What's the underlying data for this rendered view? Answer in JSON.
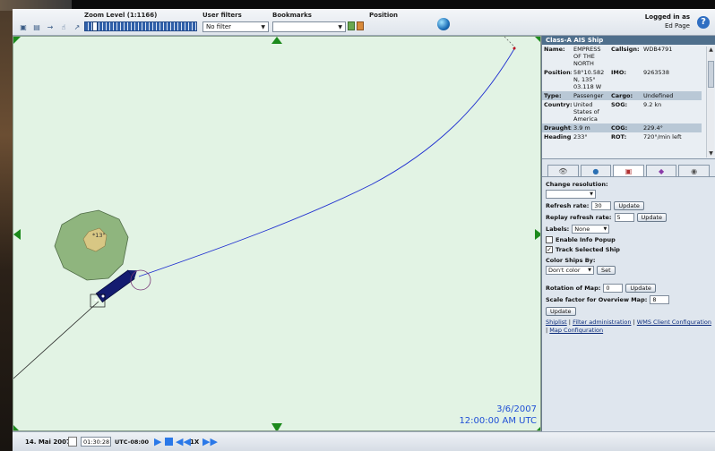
{
  "toolbar": {
    "zoom_label": "Zoom Level (1:1166)",
    "user_filters_label": "User filters",
    "user_filters_value": "No filter",
    "bookmarks_label": "Bookmarks",
    "bookmarks_value": "",
    "position_label": "Position",
    "logged_in_label": "Logged in as",
    "username": "Ed Page",
    "help_symbol": "?"
  },
  "map": {
    "timestamp_date": "3/6/2007",
    "timestamp_time": "12:00:00 AM UTC",
    "feature_label": "*13\"",
    "colors": {
      "background": "#e2f3e4",
      "island": "#8fb57e",
      "island_core": "#d8c784",
      "ship": "#141c70",
      "track": "#2030d0",
      "marker": "#1c8a1c"
    }
  },
  "ship_info": {
    "title": "Class-A AIS Ship",
    "rows": [
      {
        "k1": "Name:",
        "v1": "EMPRESS OF THE NORTH",
        "k2": "Callsign:",
        "v2": "WDB4791"
      },
      {
        "k1": "Position:",
        "v1": "58°10.582 N, 135° 03.118 W",
        "k2": "IMO:",
        "v2": "9263538"
      },
      {
        "k1": "Type:",
        "v1": "Passenger",
        "k2": "Cargo:",
        "v2": "Undefined"
      },
      {
        "k1": "Country:",
        "v1": "United States of America",
        "k2": "SOG:",
        "v2": "9.2 kn"
      },
      {
        "k1": "Draught:",
        "v1": "3.9 m",
        "k2": "COG:",
        "v2": "229.4°"
      },
      {
        "k1": "Heading:",
        "v1": "233°",
        "k2": "ROT:",
        "v2": "720°/min left"
      }
    ]
  },
  "tabs": [
    {
      "icon": "eye-icon",
      "glyph": "👁"
    },
    {
      "icon": "globe-icon",
      "glyph": "●"
    },
    {
      "icon": "document-icon",
      "glyph": "▣"
    },
    {
      "icon": "layers-icon",
      "glyph": "◆"
    },
    {
      "icon": "view-icon",
      "glyph": "◉"
    }
  ],
  "settings": {
    "change_resolution_label": "Change resolution:",
    "resolution_value": "",
    "refresh_rate_label": "Refresh rate:",
    "refresh_rate_value": "30",
    "replay_refresh_label": "Replay refresh rate:",
    "replay_refresh_value": "5",
    "update_label": "Update",
    "labels_label": "Labels:",
    "labels_value": "None",
    "enable_info_popup_label": "Enable Info Popup",
    "track_selected_ship_label": "Track Selected Ship",
    "color_ships_label": "Color Ships By:",
    "color_ships_value": "Don't color",
    "set_label": "Set",
    "rotation_label": "Rotation of Map:",
    "rotation_value": "0",
    "scale_label": "Scale factor for Overview Map:",
    "scale_value": "8",
    "links": [
      "Shiplist",
      "Filter administration",
      "WMS Client Configuration",
      "Map Configuration"
    ]
  },
  "bottombar": {
    "date": "14. Mai 2007",
    "time": "01:30:28",
    "timezone": "UTC-08:00",
    "speed": "1X"
  }
}
